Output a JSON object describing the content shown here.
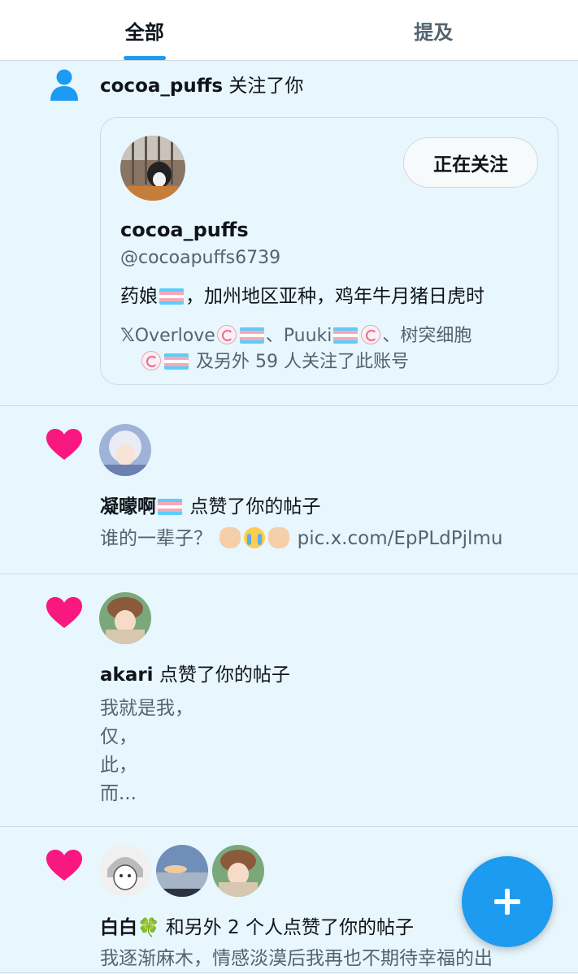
{
  "tabs": [
    {
      "label": "全部",
      "active": true
    },
    {
      "label": "提及",
      "active": false
    }
  ],
  "follow_notification": {
    "username": "cocoa_puffs",
    "action": "关注了你",
    "card": {
      "display_name": "cocoa_puffs",
      "handle": "@cocoapuffs6739",
      "bio_prefix": "药娘",
      "bio_suffix": "，加州地区亚种，鸡年牛月猪日虎时",
      "follow_button": "正在关注",
      "followed_by_part1": "Overlove",
      "followed_by_sep1": "、Puuki",
      "followed_by_sep2": "、树突细胞",
      "followed_by_tail": "及另外 59 人关注了此账号"
    }
  },
  "likes": [
    {
      "user": "凝曚啊",
      "action": "点赞了你的帖子",
      "snippet_prefix": "谁的一辈子？",
      "snippet_link": "pic.x.com/EpPLdPjlmu"
    },
    {
      "user": "akari",
      "action": "点赞了你的帖子",
      "snippet_lines": [
        "我就是我，",
        "仅，",
        "此，",
        "而..."
      ]
    },
    {
      "user": "白白",
      "action": "和另外 2 个人点赞了你的帖子",
      "snippet": "我逐渐麻木，情感淡漠后我再也不期待幸福的出"
    }
  ],
  "colors": {
    "accent": "#1d9bf0",
    "heart": "#f91880",
    "background": "#e8f6fd"
  },
  "icons": [
    "person-icon",
    "heart-icon",
    "plus-icon",
    "x-logo-icon"
  ]
}
